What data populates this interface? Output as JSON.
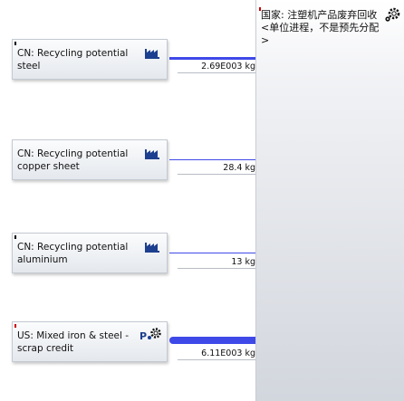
{
  "processes": [
    {
      "title": "CN: Recycling potential steel",
      "icon": "factory-icon"
    },
    {
      "title": "CN: Recycling potential copper sheet",
      "icon": "factory-icon"
    },
    {
      "title": "CN: Recycling potential aluminium",
      "icon": "factory-icon"
    },
    {
      "title": "US: Mixed iron & steel - scrap credit",
      "icon": "ps-gear-icon"
    }
  ],
  "flows": [
    {
      "amount": "2.69E003 kg"
    },
    {
      "amount": "28.4 kg"
    },
    {
      "amount": "13 kg"
    },
    {
      "amount": "6.11E003 kg"
    }
  ],
  "target": {
    "title": "国家: 注塑机产品废弃回收 <单位进程，不是预先分配>",
    "icon": "gear-icon"
  },
  "colors": {
    "flow": "#3f49e8",
    "marker_red": "#cc0000"
  }
}
